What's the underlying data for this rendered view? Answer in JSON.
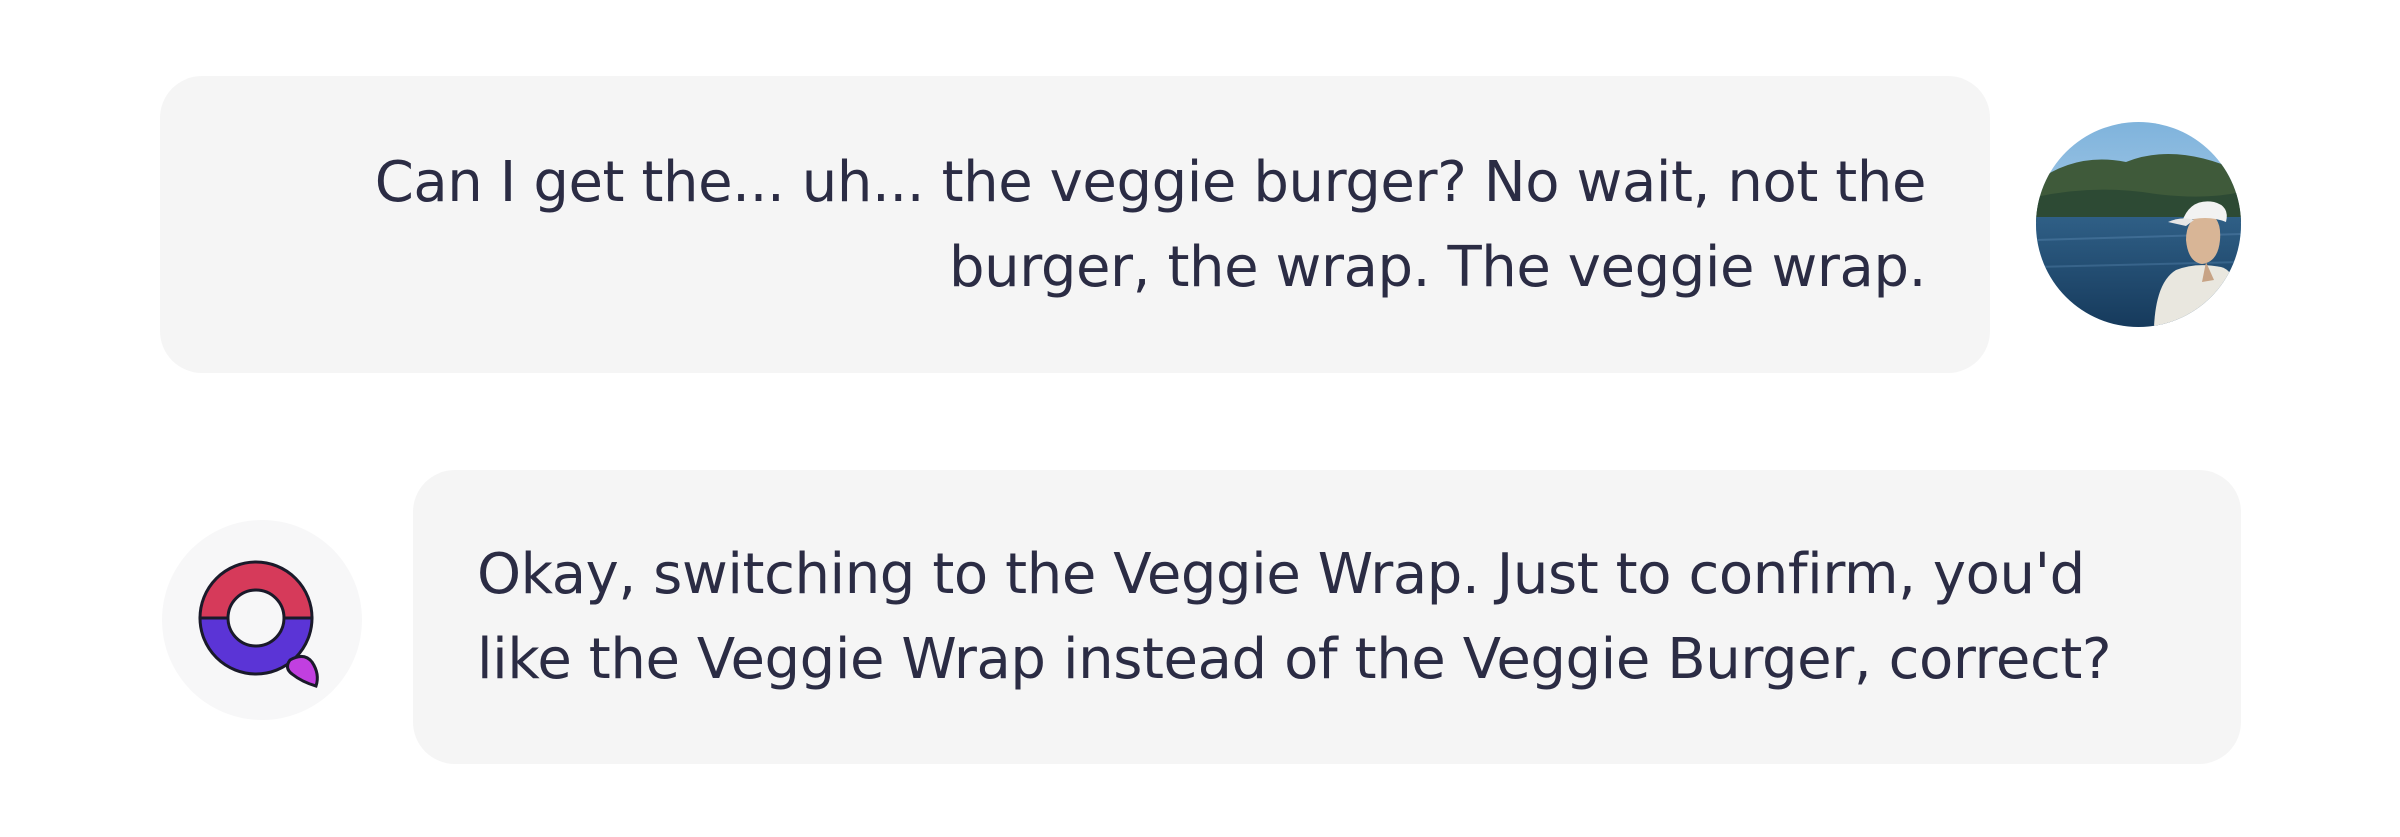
{
  "conversation": {
    "messages": [
      {
        "role": "user",
        "text": "Can I get the... uh... the veggie burger? No wait, not the\nburger, the wrap. The veggie wrap.",
        "avatar_icon": "user-photo-avatar"
      },
      {
        "role": "assistant",
        "text": "Okay, switching to the Veggie Wrap. Just to confirm, you'd\nlike the Veggie Wrap instead of the Veggie Burger, correct?",
        "avatar_icon": "assistant-q-logo-icon"
      }
    ]
  },
  "colors": {
    "bubble_background": "#f5f5f5",
    "text": "#2b2c44",
    "logo_top": "#d63a5a",
    "logo_bottom": "#5b34d6",
    "logo_tail": "#c13fe0"
  }
}
